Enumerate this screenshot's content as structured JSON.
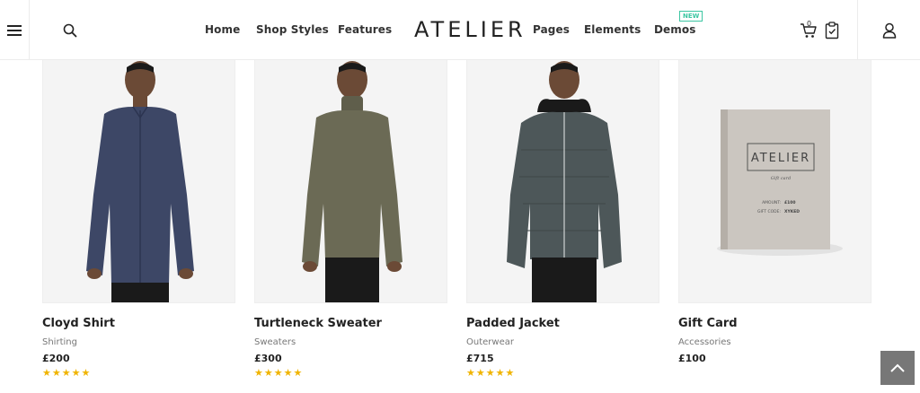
{
  "header": {
    "logo": "ATELIER",
    "nav_left": [
      "Home",
      "Shop Styles",
      "Features"
    ],
    "nav_right": [
      "Pages",
      "Elements",
      "Demos"
    ],
    "demos_badge": "NEW",
    "cart_count": "0"
  },
  "icons": {
    "menu": "hamburger-icon",
    "search": "search-icon",
    "cart": "cart-icon",
    "wishlist": "clipboard-icon",
    "account": "user-icon",
    "back_to_top": "chevron-up-icon"
  },
  "products": [
    {
      "name": "Cloyd Shirt",
      "category": "Shirting",
      "price": "£200",
      "rating": 5,
      "stars": "★★★★★",
      "garment_color": "#3d4766"
    },
    {
      "name": "Turtleneck Sweater",
      "category": "Sweaters",
      "price": "£300",
      "rating": 5,
      "stars": "★★★★★",
      "garment_color": "#6b6a55"
    },
    {
      "name": "Padded Jacket",
      "category": "Outerwear",
      "price": "£715",
      "rating": 5,
      "stars": "★★★★★",
      "garment_color": "#4d5759"
    },
    {
      "name": "Gift Card",
      "category": "Accessories",
      "price": "£100"
    }
  ],
  "gift_card": {
    "brand": "ATELIER",
    "subtitle": "Gift card",
    "amount_label": "AMOUNT:",
    "amount_value": "£100",
    "code_label": "GIFT CODE:",
    "code_value": "XYKED"
  },
  "colors": {
    "star": "#f0b400",
    "new_badge": "#3cc6a2",
    "back_to_top_bg": "#777777"
  }
}
